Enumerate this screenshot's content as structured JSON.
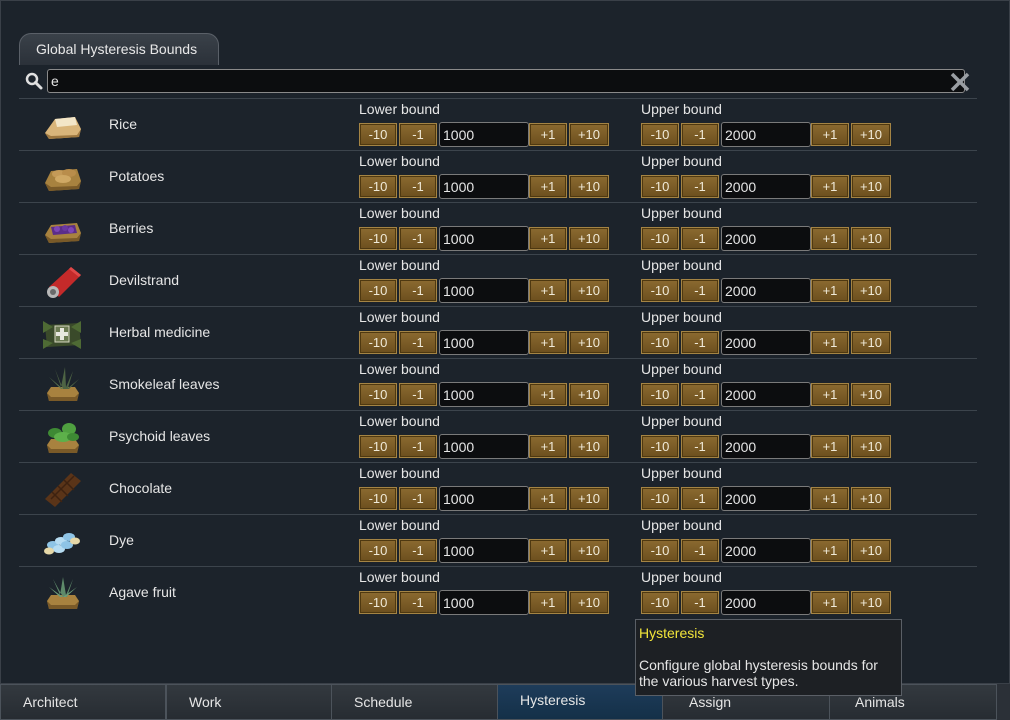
{
  "panel": {
    "title": "Global Hysteresis Bounds",
    "search_value": "e"
  },
  "labels": {
    "lower": "Lower bound",
    "upper": "Upper bound",
    "minus10": "-10",
    "minus1": "-1",
    "plus1": "+1",
    "plus10": "+10"
  },
  "items": [
    {
      "name": "Rice",
      "icon": "rice-icon",
      "lower": "1000",
      "upper": "2000"
    },
    {
      "name": "Potatoes",
      "icon": "potatoes-icon",
      "lower": "1000",
      "upper": "2000"
    },
    {
      "name": "Berries",
      "icon": "berries-icon",
      "lower": "1000",
      "upper": "2000"
    },
    {
      "name": "Devilstrand",
      "icon": "devilstrand-icon",
      "lower": "1000",
      "upper": "2000"
    },
    {
      "name": "Herbal medicine",
      "icon": "herbal-medicine-icon",
      "lower": "1000",
      "upper": "2000"
    },
    {
      "name": "Smokeleaf leaves",
      "icon": "smokeleaf-icon",
      "lower": "1000",
      "upper": "2000"
    },
    {
      "name": "Psychoid leaves",
      "icon": "psychoid-icon",
      "lower": "1000",
      "upper": "2000"
    },
    {
      "name": "Chocolate",
      "icon": "chocolate-icon",
      "lower": "1000",
      "upper": "2000"
    },
    {
      "name": "Dye",
      "icon": "dye-icon",
      "lower": "1000",
      "upper": "2000"
    },
    {
      "name": "Agave fruit",
      "icon": "agave-icon",
      "lower": "1000",
      "upper": "2000"
    }
  ],
  "tooltip": {
    "title": "Hysteresis",
    "body": "Configure global hysteresis bounds for the various harvest types."
  },
  "bottom_tabs": [
    {
      "label": "Architect"
    },
    {
      "label": "Work"
    },
    {
      "label": "Schedule"
    },
    {
      "label": "Hysteresis",
      "active": true
    },
    {
      "label": "Assign"
    },
    {
      "label": "Animals"
    }
  ],
  "colors": {
    "accent_tooltip_title": "#f2e53a",
    "button": "#7a5c28",
    "active_tab": "#1e3c5a"
  }
}
